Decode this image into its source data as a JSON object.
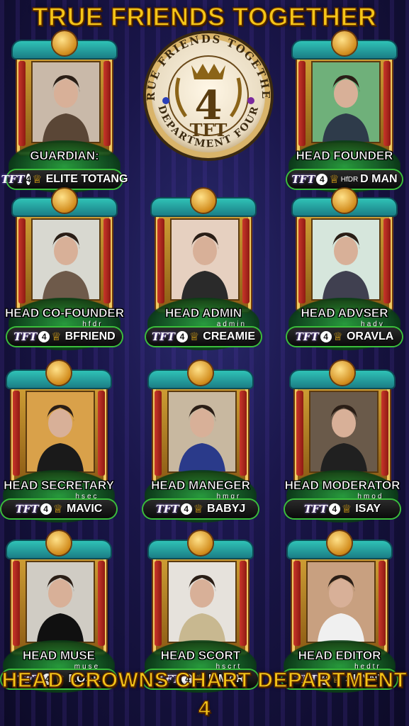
{
  "header": {
    "title": "TRUE FRIENDS TOGETHER"
  },
  "footer": {
    "title": "HEAD CROWNS CHART DEPARTMENT 4"
  },
  "badge": {
    "arc_top": "TRUE FRIENDS TOGETHER",
    "number": "4",
    "abbr": "TFT",
    "arc_bottom": "DEPARTMENT FOUR"
  },
  "tag": {
    "tft": "TFT",
    "four": "4",
    "crown_icon": "crown-icon"
  },
  "members": [
    {
      "role": "GUARDIAN:",
      "sub": "",
      "prefix": "",
      "name": "ELITE TOTANG"
    },
    {
      "role": "HEAD FOUNDER",
      "sub": "",
      "prefix": "HfDR",
      "name": "D MAN"
    },
    {
      "role": "HEAD CO-FOUNDER",
      "sub": "hfdr",
      "prefix": "",
      "name": "BFRIEND"
    },
    {
      "role": "HEAD ADMIN",
      "sub": "admin",
      "prefix": "",
      "name": "CREAMIE"
    },
    {
      "role": "HEAD ADVSER",
      "sub": "hadv",
      "prefix": "",
      "name": "ORAVLA"
    },
    {
      "role": "HEAD SECRETARY",
      "sub": "hsec",
      "prefix": "",
      "name": "MAVIC"
    },
    {
      "role": "HEAD MANEGER",
      "sub": "hmgr",
      "prefix": "",
      "name": "BABYJ"
    },
    {
      "role": "HEAD MODERATOR",
      "sub": "hmod",
      "prefix": "",
      "name": "ISAY"
    },
    {
      "role": "HEAD MUSE",
      "sub": "muse",
      "prefix": "",
      "name": "ROSE"
    },
    {
      "role": "HEAD SCORT",
      "sub": "hscrt",
      "prefix": "",
      "name": "LIMAR"
    },
    {
      "role": "HEAD EDITOR",
      "sub": "hedtr",
      "prefix": "",
      "name": "SUNNY"
    }
  ]
}
